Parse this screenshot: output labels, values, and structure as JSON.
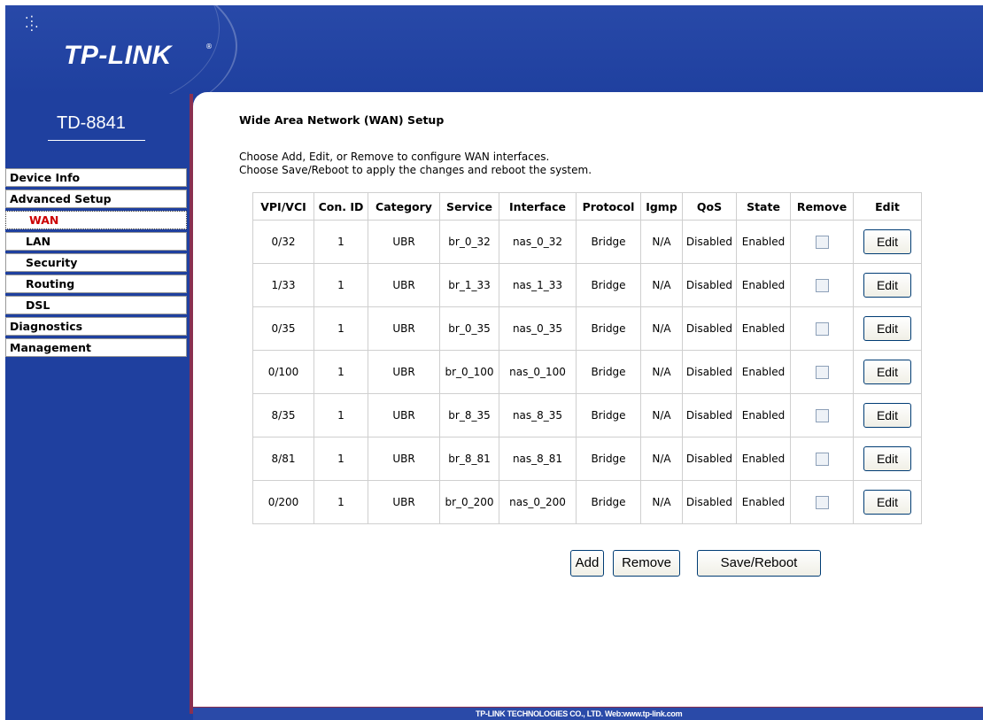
{
  "header": {
    "brand": "TP-LINK",
    "brand_mark": "®",
    "model": "TD-8841"
  },
  "sidebar": {
    "items": [
      {
        "label": "Device Info",
        "level": 0,
        "active": false
      },
      {
        "label": "Advanced Setup",
        "level": 0,
        "active": false
      },
      {
        "label": "WAN",
        "level": 1,
        "active": true
      },
      {
        "label": "LAN",
        "level": 1,
        "active": false
      },
      {
        "label": "Security",
        "level": 1,
        "active": false
      },
      {
        "label": "Routing",
        "level": 1,
        "active": false
      },
      {
        "label": "DSL",
        "level": 1,
        "active": false
      },
      {
        "label": "Diagnostics",
        "level": 0,
        "active": false
      },
      {
        "label": "Management",
        "level": 0,
        "active": false
      }
    ]
  },
  "main": {
    "title": "Wide Area Network (WAN) Setup",
    "description_1": "Choose Add, Edit, or Remove to configure WAN interfaces.",
    "description_2": "Choose Save/Reboot to apply the changes and reboot the system.",
    "table": {
      "headers": [
        "VPI/VCI",
        "Con. ID",
        "Category",
        "Service",
        "Interface",
        "Protocol",
        "Igmp",
        "QoS",
        "State",
        "Remove",
        "Edit"
      ],
      "rows": [
        [
          "0/32",
          "1",
          "UBR",
          "br_0_32",
          "nas_0_32",
          "Bridge",
          "N/A",
          "Disabled",
          "Enabled"
        ],
        [
          "1/33",
          "1",
          "UBR",
          "br_1_33",
          "nas_1_33",
          "Bridge",
          "N/A",
          "Disabled",
          "Enabled"
        ],
        [
          "0/35",
          "1",
          "UBR",
          "br_0_35",
          "nas_0_35",
          "Bridge",
          "N/A",
          "Disabled",
          "Enabled"
        ],
        [
          "0/100",
          "1",
          "UBR",
          "br_0_100",
          "nas_0_100",
          "Bridge",
          "N/A",
          "Disabled",
          "Enabled"
        ],
        [
          "8/35",
          "1",
          "UBR",
          "br_8_35",
          "nas_8_35",
          "Bridge",
          "N/A",
          "Disabled",
          "Enabled"
        ],
        [
          "8/81",
          "1",
          "UBR",
          "br_8_81",
          "nas_8_81",
          "Bridge",
          "N/A",
          "Disabled",
          "Enabled"
        ],
        [
          "0/200",
          "1",
          "UBR",
          "br_0_200",
          "nas_0_200",
          "Bridge",
          "N/A",
          "Disabled",
          "Enabled"
        ]
      ],
      "edit_label": "Edit"
    },
    "buttons": {
      "add": "Add",
      "remove": "Remove",
      "save_reboot": "Save/Reboot"
    }
  },
  "footer": {
    "text": "TP-LINK TECHNOLOGIES CO., LTD. Web:www.tp-link.com"
  },
  "colors": {
    "frame_blue": "#1f409f",
    "active_menu": "#cc0000",
    "edge_maroon": "#8a3050"
  }
}
